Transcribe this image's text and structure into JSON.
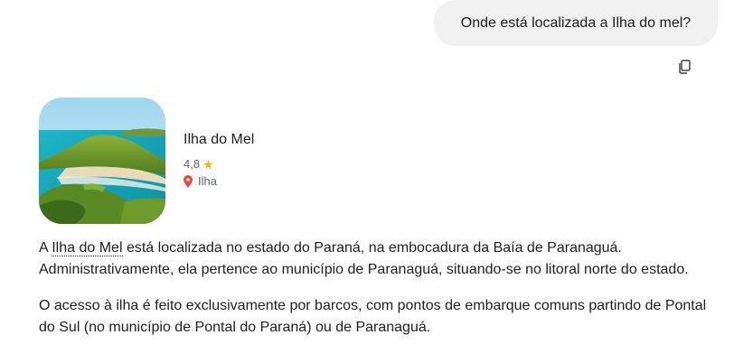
{
  "user_message": "Onde está localizada a Ilha do mel?",
  "place": {
    "name": "Ilha do Mel",
    "rating": "4,8",
    "type": "Ilha"
  },
  "answer": {
    "p1_prefix": "A ",
    "p1_link": "Ilha do Mel",
    "p1_suffix": " está localizada no estado do Paraná, na embocadura da Baía de Paranaguá. Administrativamente, ela pertence ao município de Paranaguá, situando-se no litoral norte do estado.",
    "p2": "O acesso à ilha é feito exclusivamente por barcos, com pontos de embarque comuns partindo de Pontal do Sul (no município de Pontal do Paraná) ou de Paranaguá."
  },
  "icons": {
    "copy": "copy-icon",
    "star": "star-icon",
    "pin": "map-pin-icon"
  },
  "colors": {
    "bubble_bg": "#f0f0f0",
    "star": "#f2b600",
    "pin": "#e8453c"
  }
}
